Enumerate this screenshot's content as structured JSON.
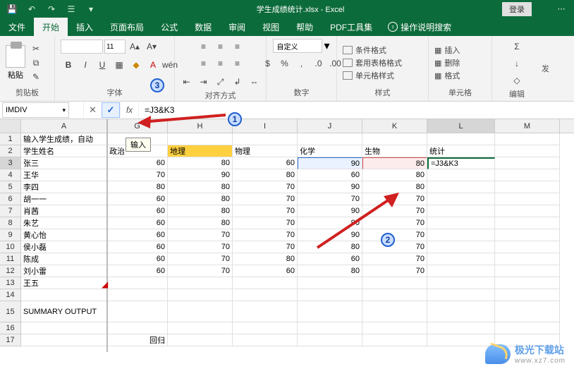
{
  "title": "学生成绩统计.xlsx - Excel",
  "login": "登录",
  "tabs": {
    "t0": "文件",
    "t1": "开始",
    "t2": "插入",
    "t3": "页面布局",
    "t4": "公式",
    "t5": "数据",
    "t6": "审阅",
    "t7": "视图",
    "t8": "帮助",
    "t9": "PDF工具集",
    "tell": "操作说明搜索"
  },
  "ribbon": {
    "clipboard": {
      "paste": "粘贴",
      "label": "剪贴板"
    },
    "font": {
      "name": "",
      "size": "11",
      "label": "字体"
    },
    "align": {
      "label": "对齐方式"
    },
    "number": {
      "sel": "自定义",
      "label": "数字"
    },
    "styles": {
      "cond": "条件格式",
      "tbl": "套用表格格式",
      "cell": "单元格样式",
      "label": "样式"
    },
    "cells": {
      "ins": "插入",
      "del": "删除",
      "fmt": "格式",
      "label": "单元格"
    },
    "edit": {
      "label": "编辑",
      "op": "发"
    }
  },
  "fbar": {
    "name": "IMDIV",
    "formula": "=J3&K3",
    "tooltip": "输入"
  },
  "annotations": {
    "a1": "1",
    "a2": "2",
    "a3": "3"
  },
  "sheet": {
    "cols": [
      "A",
      "G",
      "H",
      "I",
      "J",
      "K",
      "L",
      "M"
    ],
    "r1": {
      "a": "输入学生成绩，自动"
    },
    "r2": {
      "a": "学生姓名",
      "g": "政治",
      "h": "地理",
      "i": "物理",
      "j": "化学",
      "k": "生物",
      "l": "统计"
    },
    "r3": {
      "a": "张三",
      "g": "60",
      "h": "80",
      "i": "60",
      "j": "90",
      "k": "80",
      "l": "=J3&K3"
    },
    "r4": {
      "a": "王华",
      "g": "70",
      "h": "90",
      "i": "80",
      "j": "60",
      "k": "80"
    },
    "r5": {
      "a": "李四",
      "g": "80",
      "h": "80",
      "i": "70",
      "j": "90",
      "k": "80"
    },
    "r6": {
      "a": "胡一一",
      "g": "60",
      "h": "80",
      "i": "70",
      "j": "70",
      "k": "70"
    },
    "r7": {
      "a": "肖茜",
      "g": "60",
      "h": "80",
      "i": "70",
      "j": "90",
      "k": "70"
    },
    "r8": {
      "a": "朱艺",
      "g": "60",
      "h": "80",
      "i": "70",
      "j": "90",
      "k": "70"
    },
    "r9": {
      "a": "黄心怡",
      "g": "60",
      "h": "70",
      "i": "70",
      "j": "90",
      "k": "70"
    },
    "r10": {
      "a": "侯小磊",
      "g": "60",
      "h": "70",
      "i": "70",
      "j": "80",
      "k": "70"
    },
    "r11": {
      "a": "陈成",
      "g": "60",
      "h": "70",
      "i": "80",
      "j": "60",
      "k": "70"
    },
    "r12": {
      "a": "刘小雷",
      "g": "60",
      "h": "70",
      "i": "60",
      "j": "80",
      "k": "70"
    },
    "r13": {
      "a": "王五"
    },
    "r14": {},
    "r15": {
      "a": "SUMMARY OUTPUT"
    },
    "r16": {},
    "r17": {
      "g": "回归"
    }
  },
  "watermark": {
    "name": "极光下载站",
    "url": "www.xz7.com"
  }
}
